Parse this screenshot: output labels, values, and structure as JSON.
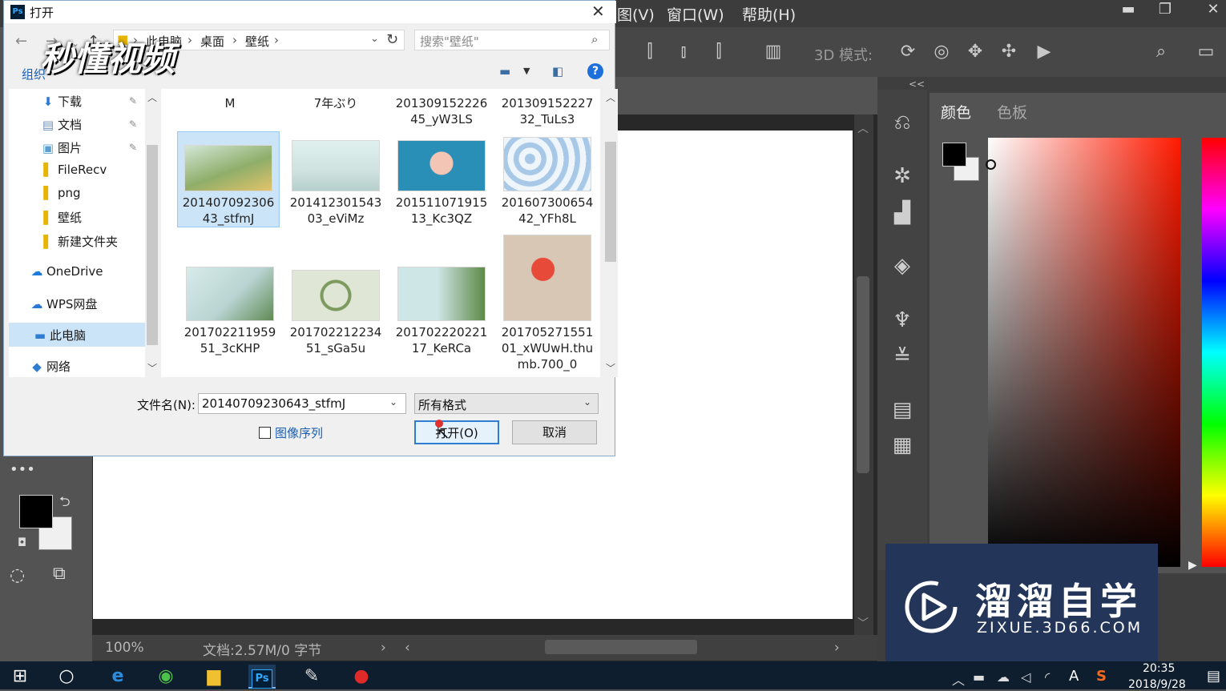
{
  "ps": {
    "menus": [
      "图(V)",
      "窗口(W)",
      "帮助(H)"
    ],
    "mode_3d": "3D 模式:",
    "panel_tabs": [
      "颜色",
      "色板"
    ],
    "zoom": "100%",
    "doc_info": "文档:2.57M/0 字节",
    "collapse": "<<"
  },
  "dialog": {
    "title": "打开",
    "ps_badge": "Ps",
    "breadcrumb": [
      "此电脑",
      "桌面",
      "壁纸"
    ],
    "search_placeholder": "搜索\"壁纸\"",
    "organize": "组织",
    "nav": [
      {
        "label": "下载",
        "icon": "download-icon",
        "pinned": true
      },
      {
        "label": "文档",
        "icon": "document-icon",
        "pinned": true
      },
      {
        "label": "图片",
        "icon": "picture-icon",
        "pinned": true
      },
      {
        "label": "FileRecv",
        "icon": "folder-icon"
      },
      {
        "label": "png",
        "icon": "folder-icon"
      },
      {
        "label": "壁纸",
        "icon": "folder-icon"
      },
      {
        "label": "新建文件夹",
        "icon": "folder-icon"
      },
      {
        "label": "OneDrive",
        "icon": "cloud-icon"
      },
      {
        "label": "WPS网盘",
        "icon": "cloud-outline-icon"
      },
      {
        "label": "此电脑",
        "icon": "computer-icon",
        "selected": true
      },
      {
        "label": "网络",
        "icon": "network-icon"
      }
    ],
    "files_top": [
      {
        "name": "M"
      },
      {
        "name": "7年ぶり"
      },
      {
        "name": "20130915222645_yW3LS"
      },
      {
        "name": "20130915222732_TuLs3"
      }
    ],
    "files": [
      {
        "name": "20140709230643_stfmJ",
        "selected": true,
        "color": "#8fae6a"
      },
      {
        "name": "20141230154303_eViMz",
        "color": "#cfe2e0"
      },
      {
        "name": "20151107191513_Kc3QZ",
        "color": "#2a8fb6"
      },
      {
        "name": "20160730065442_YFh8L",
        "color": "#d8e8f4"
      },
      {
        "name": "20170221195951_3cKHP",
        "color": "#b9d4d2"
      },
      {
        "name": "20170221223451_sGa5u",
        "color": "#dfe6d6"
      },
      {
        "name": "20170222022117_KeRCa",
        "color": "#cfe6e6"
      },
      {
        "name": "20170527155101_xWUwH.thumb.700_0",
        "color": "#d9c7b6"
      }
    ],
    "filename_label": "文件名(N):",
    "filename_value": "20140709230643_stfmJ",
    "filetype": "所有格式",
    "image_sequence": "图像序列",
    "open_button": "打开(O)",
    "cancel_button": "取消"
  },
  "watermark_left": "秒懂视频",
  "watermark_right": {
    "title": "溜溜自学",
    "url": "ZIXUE.3D66.COM"
  },
  "taskbar": {
    "time": "20:35",
    "date": "2018/9/28",
    "ime": "A",
    "ps_label": "Ps"
  }
}
